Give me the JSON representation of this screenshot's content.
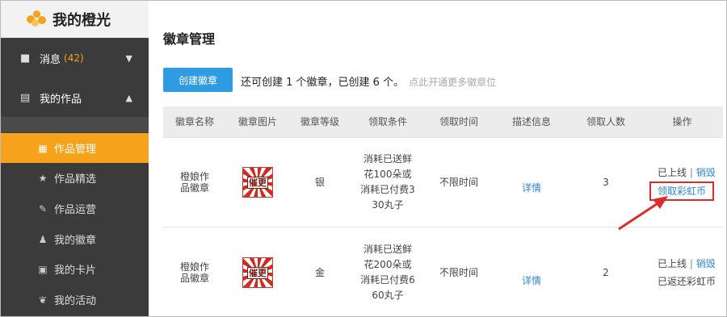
{
  "sidebar": {
    "brand": "我的橙光",
    "messages": {
      "label": "消息",
      "count": "(42)"
    },
    "works": {
      "label": "我的作品"
    },
    "items": [
      {
        "label": "作品管理",
        "icon": "grid-icon"
      },
      {
        "label": "作品精选",
        "icon": "star-icon"
      },
      {
        "label": "作品运营",
        "icon": "edit-icon"
      },
      {
        "label": "我的徽章",
        "icon": "user-badge-icon"
      },
      {
        "label": "我的卡片",
        "icon": "card-icon"
      },
      {
        "label": "我的活动",
        "icon": "paw-icon"
      }
    ]
  },
  "main": {
    "title": "徽章管理",
    "create_button": "创建徽章",
    "info_text": "还可创建 1 个徽章，已创建 6 个。",
    "info_link": "点此开通更多徽章位",
    "table": {
      "headers": [
        "徽章名称",
        "徽章图片",
        "徽章等级",
        "领取条件",
        "领取时间",
        "描述信息",
        "领取人数",
        "操作"
      ],
      "rows": [
        {
          "name": "橙娘作品徽章",
          "badge_text": "催更",
          "level": "银",
          "condition": "消耗已送鲜花100朵或消耗已付费330丸子",
          "time": "不限时间",
          "desc": "详情",
          "count": "3",
          "status": "已上线",
          "op_destroy": "销毁",
          "op_extra": "领取彩虹币"
        },
        {
          "name": "橙娘作品徽章",
          "badge_text": "催更",
          "level": "金",
          "condition": "消耗已送鲜花200朵或消耗已付费660丸子",
          "time": "不限时间",
          "desc": "详情",
          "count": "2",
          "status": "已上线",
          "op_destroy": "销毁",
          "op_extra": "已返还彩虹币"
        }
      ]
    }
  },
  "colors": {
    "accent": "#f7a21b",
    "primary": "#2f9be3",
    "sidebar": "#3b3b3b",
    "highlight": "#e02b2b"
  }
}
